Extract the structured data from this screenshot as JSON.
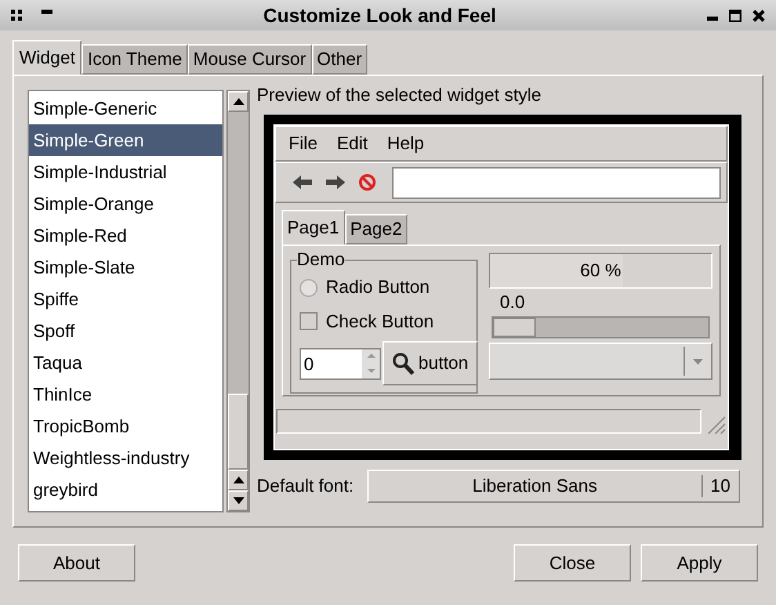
{
  "window": {
    "title": "Customize Look and Feel"
  },
  "tabs": [
    {
      "label": "Widget",
      "selected": true
    },
    {
      "label": "Icon Theme",
      "selected": false
    },
    {
      "label": "Mouse Cursor",
      "selected": false
    },
    {
      "label": "Other",
      "selected": false
    }
  ],
  "themes": [
    {
      "label": "Simple-Generic",
      "selected": false
    },
    {
      "label": "Simple-Green",
      "selected": true
    },
    {
      "label": "Simple-Industrial",
      "selected": false
    },
    {
      "label": "Simple-Orange",
      "selected": false
    },
    {
      "label": "Simple-Red",
      "selected": false
    },
    {
      "label": "Simple-Slate",
      "selected": false
    },
    {
      "label": "Spiffe",
      "selected": false
    },
    {
      "label": "Spoff",
      "selected": false
    },
    {
      "label": "Taqua",
      "selected": false
    },
    {
      "label": "ThinIce",
      "selected": false
    },
    {
      "label": "TropicBomb",
      "selected": false
    },
    {
      "label": "Weightless-industry",
      "selected": false
    },
    {
      "label": "greybird",
      "selected": false
    }
  ],
  "preview": {
    "label": "Preview of the selected widget style",
    "menu": [
      "File",
      "Edit",
      "Help"
    ],
    "tabs": [
      {
        "label": "Page1",
        "selected": true
      },
      {
        "label": "Page2",
        "selected": false
      }
    ],
    "group_title": "Demo",
    "radio": {
      "label": "Radio Button",
      "selected": false
    },
    "check": {
      "label": "Check Button",
      "checked": false
    },
    "spin_value": "0",
    "button": "button",
    "progress": {
      "text": "60 %",
      "level": 0.6
    },
    "slider": {
      "reading": "0.0",
      "level": 0
    }
  },
  "font": {
    "label": "Default font:",
    "family": "Liberation Sans",
    "size": "10"
  },
  "buttons": {
    "about": "About",
    "close": "Close",
    "apply": "Apply"
  }
}
